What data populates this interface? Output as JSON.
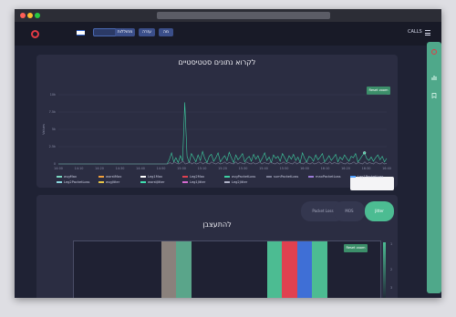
{
  "browser": {
    "url": ""
  },
  "nav": {
    "brand": "",
    "buttons": [
      {
        "label": ""
      },
      {
        "label": "מחוללות"
      },
      {
        "label": "עזרה"
      },
      {
        "label": "מה"
      }
    ],
    "right_link": "",
    "calls_label": "CALLS"
  },
  "stats_panel": {
    "title": "לקרוא נתונים סטטיסטיים",
    "subtitle": "",
    "reset_label": "Reset zoom"
  },
  "chart_data": {
    "type": "line",
    "title": "לקרוא נתונים סטטיסטיים",
    "ylabel": "Values",
    "y_ticks": [
      "10k",
      "7.5k",
      "5k",
      "2.5k",
      "0"
    ],
    "x_ticks": [
      "14:00",
      "14:10",
      "14:20",
      "14:30",
      "14:40",
      "14:50",
      "15:00",
      "15:10",
      "15:20",
      "15:30",
      "15:40",
      "15:50",
      "16:00",
      "16:10",
      "16:20",
      "16:30",
      "16:40"
    ],
    "ylim": [
      0,
      10000
    ],
    "legend": [
      {
        "name": "avgMax",
        "color": "#7bd9c2"
      },
      {
        "name": "worstMax",
        "color": "#f0a03c"
      },
      {
        "name": "Leg1Max",
        "color": "#ffffff"
      },
      {
        "name": "Leg2Max",
        "color": "#e04150"
      },
      {
        "name": "avgPacketLoss",
        "color": "#3ecfa1"
      },
      {
        "name": "sumPacketLoss",
        "color": "#7a7d94"
      },
      {
        "name": "maxPacketLoss",
        "color": "#9a7bd6"
      },
      {
        "name": "Leg1PacketLoss",
        "color": "#4fa0ff"
      },
      {
        "name": "Leg2PacketLoss",
        "color": "#8bd8e0"
      },
      {
        "name": "avgJitter",
        "color": "#e8c547"
      },
      {
        "name": "worstJitter",
        "color": "#3fe0b0"
      },
      {
        "name": "Leg1Jitter",
        "color": "#d66bd1"
      },
      {
        "name": "Leg2Jitter",
        "color": "#b0b3c8"
      }
    ],
    "series": [
      {
        "name": "avgPacketLoss",
        "color": "#3ecfa1",
        "values": [
          0,
          0,
          0,
          0,
          0,
          0,
          0,
          0,
          0,
          0,
          0,
          0,
          0,
          0,
          0,
          0,
          0,
          0,
          0,
          0,
          0,
          0,
          0,
          0,
          0,
          0,
          0,
          0,
          0,
          0,
          0,
          0,
          0,
          0,
          0,
          0,
          0,
          0,
          0,
          0,
          0,
          0,
          0,
          0,
          0,
          0,
          0,
          0,
          0,
          0,
          600,
          1600,
          300,
          900,
          200,
          1200,
          400,
          8900,
          1100,
          200,
          1500,
          900,
          300,
          1300,
          500,
          1800,
          800,
          200,
          1100,
          1400,
          400,
          900,
          1600,
          300,
          800,
          1200,
          500,
          1700,
          900,
          200,
          1300,
          600,
          1000,
          1500,
          300,
          800,
          1100,
          400,
          1400,
          700,
          1200,
          300,
          900,
          1600,
          500,
          1000,
          200,
          1300,
          800,
          1100,
          400,
          1500,
          900,
          300,
          1200,
          700,
          1400,
          500,
          1000,
          200,
          1600,
          800,
          300,
          1100,
          900,
          400,
          1300,
          600,
          1000,
          1500,
          300,
          700,
          1200,
          500,
          900,
          1400,
          300,
          1000,
          600,
          1300,
          800,
          400,
          1100,
          900,
          1500,
          300,
          700,
          1200,
          1604,
          800,
          500,
          1000,
          400,
          900,
          1300,
          600,
          1100,
          300,
          800
        ]
      },
      {
        "name": "sumPacketLoss",
        "color": "#7a7d94",
        "values": [
          0,
          0,
          0,
          0,
          0,
          0,
          0,
          0,
          0,
          0,
          0,
          0,
          0,
          0,
          0,
          0,
          0,
          0,
          0,
          0,
          0,
          0,
          0,
          0,
          0,
          0,
          0,
          0,
          0,
          0,
          0,
          0,
          0,
          0,
          0,
          0,
          0,
          0,
          0,
          0,
          0,
          0,
          0,
          0,
          0,
          0,
          0,
          0,
          0,
          0,
          0,
          200,
          0,
          300,
          100,
          0,
          200,
          400,
          0,
          100,
          300,
          0,
          200,
          0,
          100,
          300,
          0,
          200,
          100,
          0,
          300,
          100,
          0,
          200,
          0,
          100,
          300,
          0,
          200,
          100,
          0,
          300,
          0,
          200,
          100,
          0,
          300,
          100,
          0,
          200,
          0,
          100,
          300,
          0,
          200,
          100,
          0,
          300,
          100,
          0,
          200,
          0,
          100,
          300,
          0,
          200,
          100,
          0,
          300,
          0,
          200,
          100,
          0,
          300,
          100,
          0,
          200,
          0,
          100,
          300,
          0,
          200,
          100,
          0,
          300,
          0,
          200,
          100,
          0,
          300,
          100,
          0,
          200,
          0,
          100,
          300,
          0,
          200,
          100,
          0,
          300,
          0,
          200,
          100,
          0,
          300,
          100,
          0,
          200,
          0,
          100
        ]
      }
    ],
    "tooltip": {
      "date": "",
      "series": "",
      "value": ""
    }
  },
  "summary_panel": {
    "title": "להתעצבן",
    "tabs": [
      {
        "label": "Packet Loss"
      },
      {
        "label": "MOS"
      },
      {
        "label": "Jitter"
      }
    ],
    "reset_label": "Reset zoom",
    "row_label": "",
    "cells": [
      {
        "label": "",
        "color": "#8a817c"
      },
      {
        "label": "",
        "color": "#5aa58a"
      },
      {
        "label": "",
        "color": "#4cbc92"
      },
      {
        "label": "",
        "color": "#e04150"
      },
      {
        "label": "",
        "color": "#3f6fd6"
      },
      {
        "label": "",
        "color": "#4cbc92"
      }
    ],
    "scale_labels": [
      "1",
      "2",
      "3"
    ]
  }
}
